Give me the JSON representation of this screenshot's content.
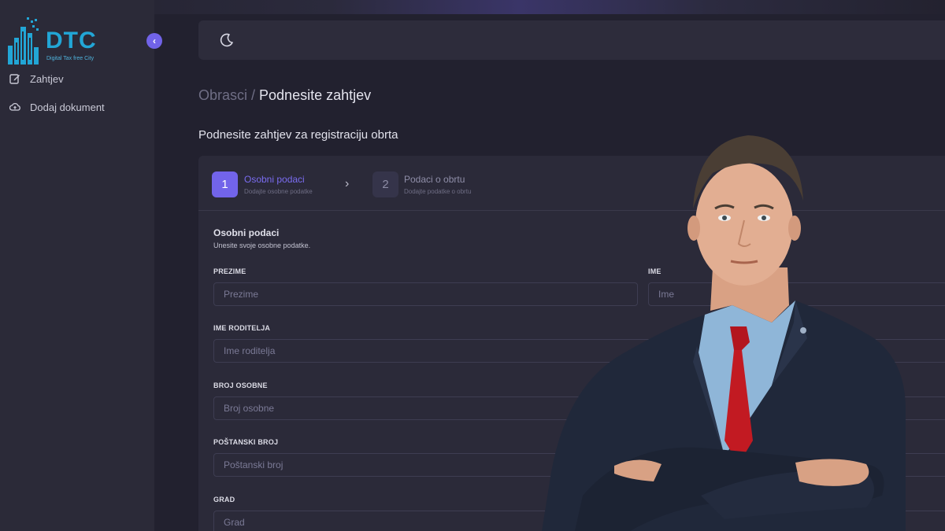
{
  "sidebar": {
    "logo_text": "DTC",
    "logo_subtitle": "Digital Tax free City",
    "items": [
      {
        "label": "Zahtjev",
        "icon": "edit-icon"
      },
      {
        "label": "Dodaj dokument",
        "icon": "cloud-upload-icon"
      }
    ],
    "collapse_icon": "chevron-left-icon"
  },
  "header": {
    "theme_icon": "moon-icon"
  },
  "breadcrumb": {
    "parent": "Obrasci",
    "separator": "/",
    "current": "Podnesite zahtjev"
  },
  "form_title": "Podnesite zahtjev za registraciju obrta",
  "stepper": {
    "steps": [
      {
        "number": "1",
        "title": "Osobni podaci",
        "subtitle": "Dodajte osobne podatke"
      },
      {
        "number": "2",
        "title": "Podaci o obrtu",
        "subtitle": "Dodajte podatke o obrtu"
      }
    ]
  },
  "section": {
    "title": "Osobni podaci",
    "subtitle": "Unesite svoje osobne podatke."
  },
  "fields": {
    "prezime": {
      "label": "PREZIME",
      "placeholder": "Prezime"
    },
    "ime": {
      "label": "IME",
      "placeholder": "Ime"
    },
    "ime_roditelja": {
      "label": "IME RODITELJA",
      "placeholder": "Ime roditelja"
    },
    "broj_osobne": {
      "label": "BROJ OSOBNE",
      "placeholder": "Broj osobne"
    },
    "postanski_broj": {
      "label": "POŠTANSKI BROJ",
      "placeholder": "Poštanski broj"
    },
    "grad": {
      "label": "GRAD",
      "placeholder": "Grad"
    }
  },
  "colors": {
    "accent": "#7264ea",
    "background": "#22212f",
    "logo": "#22a6d6"
  }
}
